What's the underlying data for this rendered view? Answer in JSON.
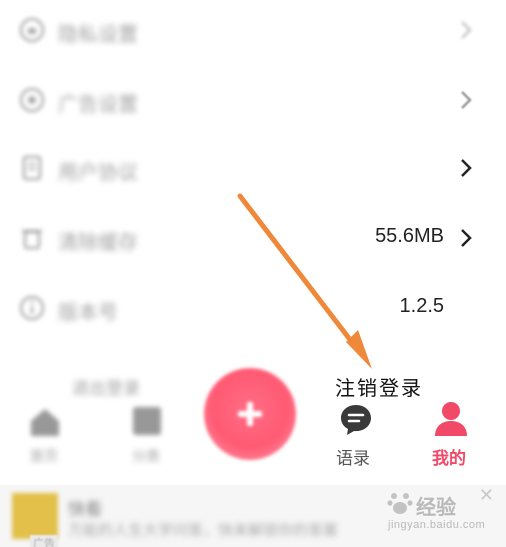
{
  "settings": {
    "rows": [
      {
        "label": "隐私设置",
        "value": ""
      },
      {
        "label": "广告设置",
        "value": ""
      },
      {
        "label": "用户协议",
        "value": ""
      },
      {
        "label": "清除缓存",
        "value": "55.6MB"
      },
      {
        "label": "版本号",
        "value": "1.2.5"
      }
    ]
  },
  "annotation": {
    "logout_text": "注销登录",
    "arrow_color": "#f0883a"
  },
  "bottom_nav": {
    "faded_label": "退出登录",
    "tabs": [
      {
        "label": "首页"
      },
      {
        "label": "分类"
      },
      {
        "label": "语录"
      },
      {
        "label": "我的"
      }
    ],
    "active_color": "#f04a68",
    "inactive_color": "#444444"
  },
  "ad": {
    "title": "快看",
    "desc": "万能的人生大学问答，快来解锁你的答案",
    "tag": "广告",
    "close": "✕"
  },
  "watermark": {
    "text": "经验",
    "url": "jingyan.baidu.com"
  }
}
